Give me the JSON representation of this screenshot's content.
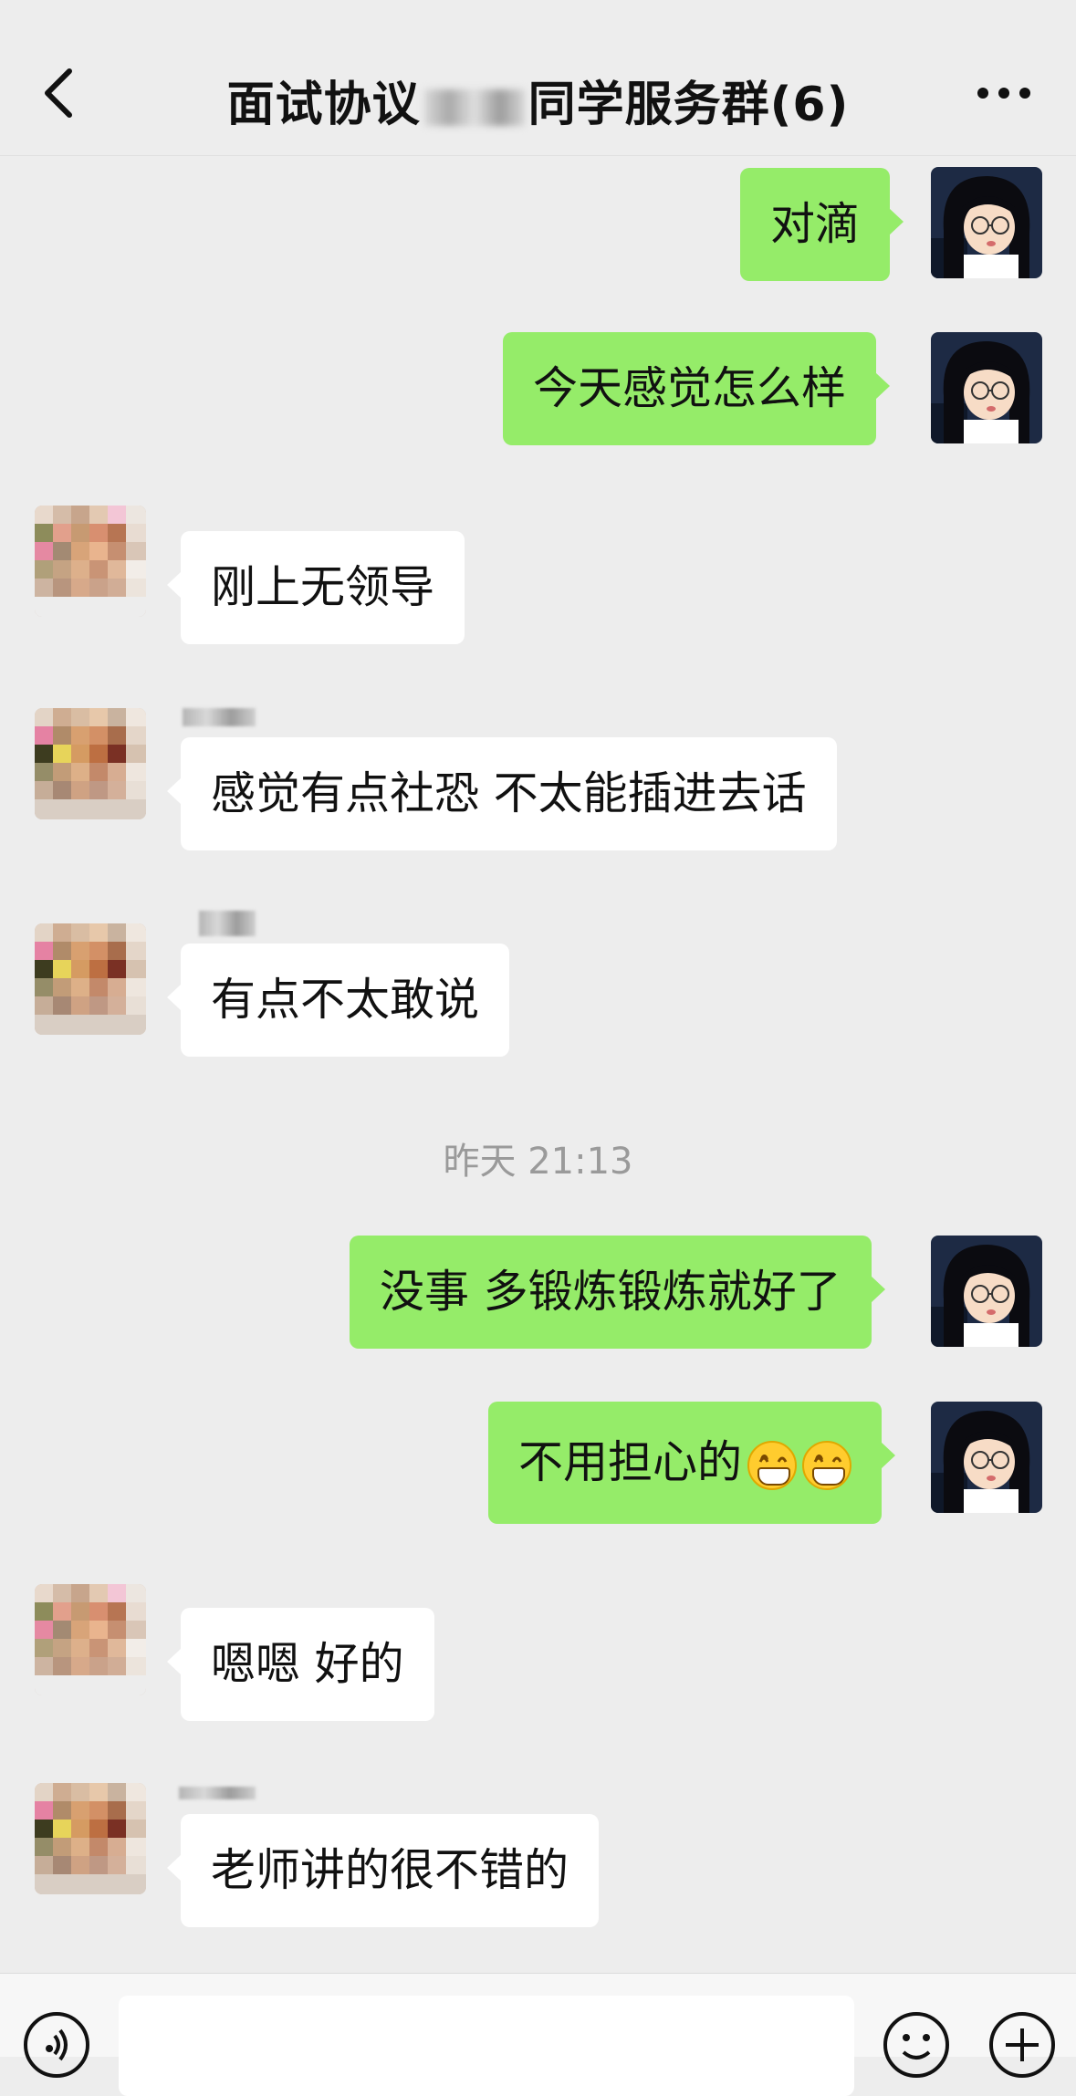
{
  "header": {
    "title_before": "面试协议",
    "title_after": "同学服务群(6)"
  },
  "messages": [
    {
      "side": "out",
      "text": "对滴"
    },
    {
      "side": "out",
      "text": "今天感觉怎么样"
    },
    {
      "side": "in",
      "text": "刚上无领导"
    },
    {
      "side": "in",
      "text": "感觉有点社恐 不太能插进去话"
    },
    {
      "side": "in",
      "text": "有点不太敢说"
    },
    {
      "side": "out",
      "text": "没事 多锻炼锻炼就好了"
    },
    {
      "side": "out",
      "text": "不用担心的"
    },
    {
      "side": "in",
      "text": "嗯嗯 好的"
    },
    {
      "side": "in",
      "text": "老师讲的很不错的"
    }
  ],
  "timestamp": "昨天 21:13",
  "emoji_after_msg7": [
    "grinning-face",
    "grinning-face"
  ],
  "colors": {
    "background": "#ededed",
    "outgoing_bubble": "#95ec69",
    "incoming_bubble": "#ffffff"
  },
  "icons": {
    "back": "chevron-left-icon",
    "more": "more-dots-icon",
    "voice": "voice-icon",
    "emoji": "emoji-icon",
    "plus": "plus-icon"
  }
}
